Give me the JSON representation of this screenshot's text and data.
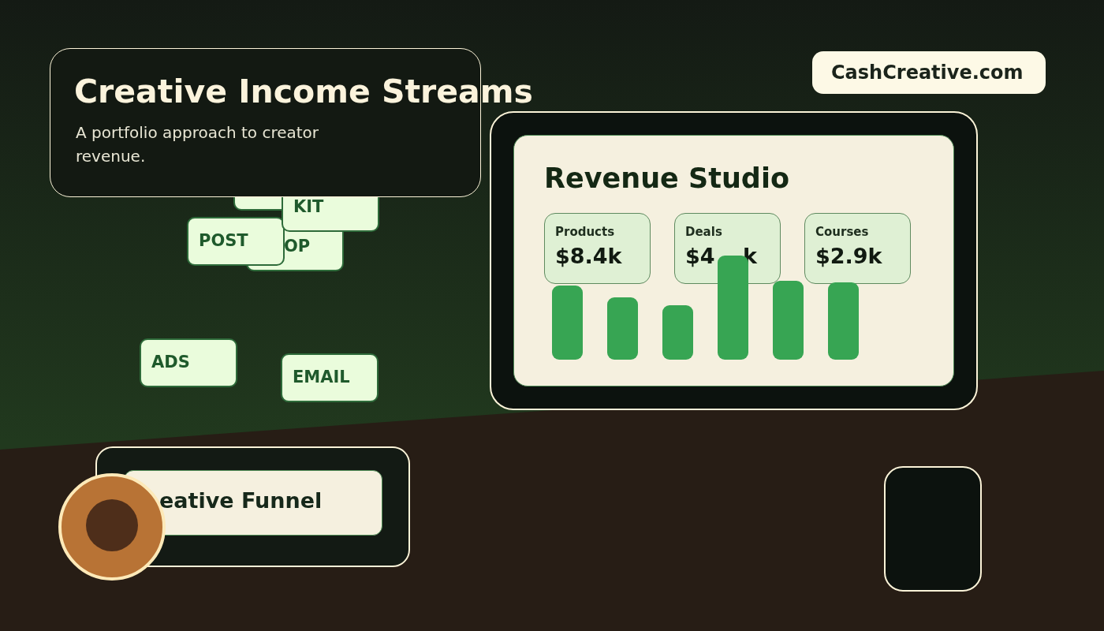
{
  "header": {
    "title": "Creative Income Streams",
    "subtitle": "A portfolio approach to creator revenue."
  },
  "site_badge": {
    "label": "CashCreative.com"
  },
  "tags": [
    {
      "label": "KIT"
    },
    {
      "label": "OP"
    },
    {
      "label": "POST"
    },
    {
      "label": "ADS"
    },
    {
      "label": "EMAIL"
    }
  ],
  "dashboard": {
    "title": "Revenue Studio",
    "metrics": [
      {
        "label": "Products",
        "value": "$8.4k"
      },
      {
        "label": "Deals",
        "value": "$4",
        "value_tail": "k"
      },
      {
        "label": "Courses",
        "value": "$2.9k"
      }
    ]
  },
  "funnel": {
    "label": "eative Funnel"
  }
}
